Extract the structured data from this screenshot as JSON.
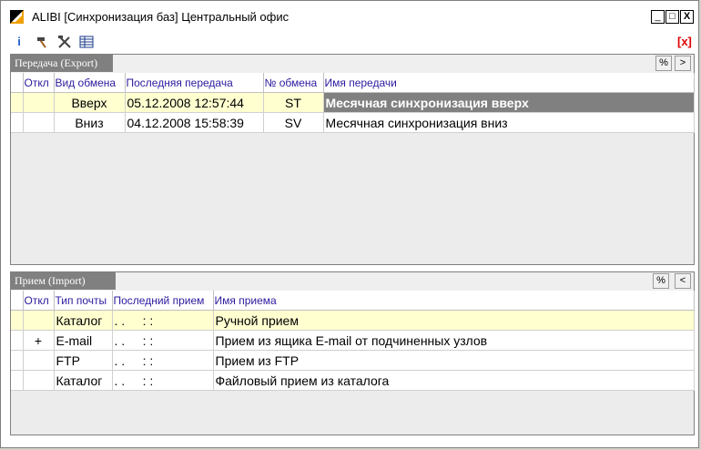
{
  "window": {
    "title": "ALIBI [Синхронизация баз] Центральный офис",
    "minimize": "_",
    "maximize": "□",
    "close": "X",
    "close_red": "[x]"
  },
  "toolbar": {
    "icons": [
      "info-icon",
      "hammer-icon",
      "tools-icon",
      "table-icon"
    ]
  },
  "export": {
    "tab_label": "Передача (Export)",
    "btn_percent": "%",
    "btn_next": ">",
    "columns": [
      "Откл",
      "Вид обмена",
      "Последняя передача",
      "№ обмена",
      "Имя передачи"
    ],
    "rows": [
      {
        "off": "",
        "type": "Вверх",
        "last": "05.12.2008 12:57:44",
        "num": "ST",
        "name": "Месячная синхронизация вверх"
      },
      {
        "off": "",
        "type": "Вниз",
        "last": "04.12.2008 15:58:39",
        "num": "SV",
        "name": "Месячная синхронизация вниз"
      }
    ]
  },
  "import": {
    "tab_label": "Прием (Import)",
    "btn_percent": "%",
    "btn_prev": "<",
    "columns": [
      "Откл",
      "Тип почты",
      "Последний прием",
      "Имя приема"
    ],
    "rows": [
      {
        "off": "",
        "mail": "Каталог",
        "last": ". .     : :",
        "name": "Ручной прием"
      },
      {
        "off": "+",
        "mail": "E-mail",
        "last": ". .     : :",
        "name": "Прием из ящика E-mail от подчиненных узлов"
      },
      {
        "off": "",
        "mail": "FTP",
        "last": ". .     : :",
        "name": "Прием из FTP"
      },
      {
        "off": "",
        "mail": "Каталог",
        "last": ". .     : :",
        "name": "Файловый прием из каталога"
      }
    ]
  }
}
